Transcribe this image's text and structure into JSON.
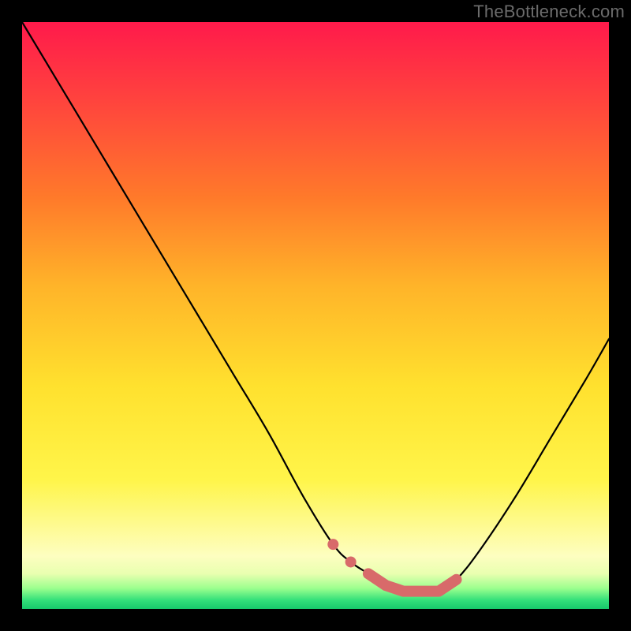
{
  "watermark": "TheBottleneck.com",
  "colors": {
    "curve": "#000000",
    "marker": "#d86a6a",
    "background_top": "#ff1a4b",
    "background_bottom": "#17c96b",
    "frame": "#000000"
  },
  "chart_data": {
    "type": "line",
    "title": "",
    "xlabel": "",
    "ylabel": "",
    "xlim": [
      0,
      100
    ],
    "ylim": [
      0,
      100
    ],
    "grid": false,
    "legend": false,
    "series": [
      {
        "name": "bottleneck-curve",
        "x": [
          0,
          6,
          12,
          18,
          24,
          30,
          36,
          42,
          48,
          53,
          56,
          59,
          62,
          65,
          68,
          71,
          74,
          78,
          84,
          90,
          96,
          100
        ],
        "values": [
          100,
          90,
          80,
          70,
          60,
          50,
          40,
          30,
          19,
          11,
          8,
          6,
          4,
          3,
          3,
          3,
          5,
          10,
          19,
          29,
          39,
          46
        ]
      },
      {
        "name": "optimal-zone-markers",
        "x": [
          53,
          56,
          59,
          62,
          65,
          68,
          71,
          74
        ],
        "values": [
          11,
          8,
          6,
          4,
          3,
          3,
          3,
          5
        ]
      }
    ],
    "annotations": []
  }
}
